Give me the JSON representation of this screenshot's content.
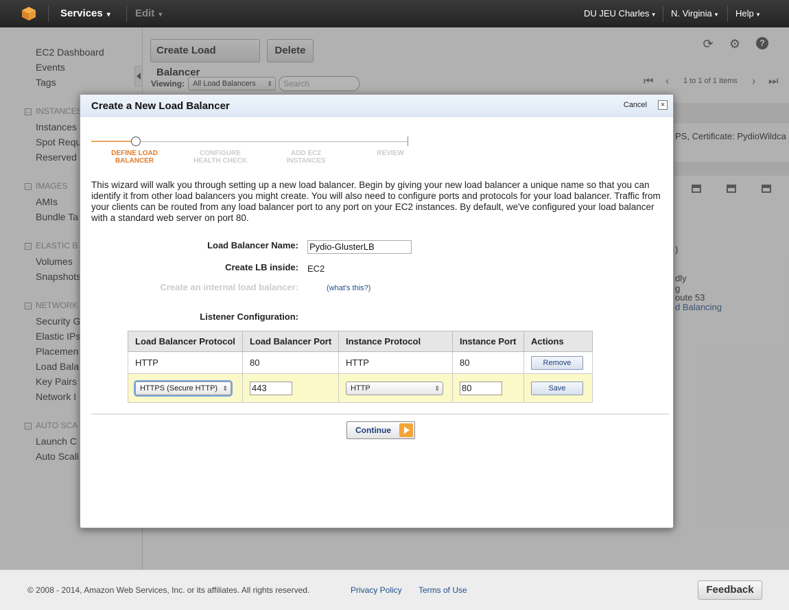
{
  "topbar": {
    "services_label": "Services",
    "edit_label": "Edit",
    "user_label": "DU JEU Charles",
    "region_label": "N. Virginia",
    "help_label": "Help"
  },
  "sidebar": {
    "items": [
      {
        "label": "EC2 Dashboard"
      },
      {
        "label": "Events"
      },
      {
        "label": "Tags"
      },
      {
        "label": "Instances"
      },
      {
        "label": "Spot Requ"
      },
      {
        "label": "Reserved"
      },
      {
        "label": "AMIs"
      },
      {
        "label": "Bundle Ta"
      },
      {
        "label": "Volumes"
      },
      {
        "label": "Snapshots"
      },
      {
        "label": "Security G"
      },
      {
        "label": "Elastic IPs"
      },
      {
        "label": "Placemen"
      },
      {
        "label": "Load Bala"
      },
      {
        "label": "Key Pairs"
      },
      {
        "label": "Network I"
      },
      {
        "label": "Launch C"
      },
      {
        "label": "Auto Scali"
      }
    ],
    "sections": [
      {
        "label": "INSTANCES"
      },
      {
        "label": "IMAGES"
      },
      {
        "label": "ELASTIC B"
      },
      {
        "label": "NETWORK"
      },
      {
        "label": "AUTO SCA"
      }
    ]
  },
  "toolbar": {
    "create_label": "Create Load Balancer",
    "delete_label": "Delete",
    "viewing_label": "Viewing:",
    "viewing_value": "All Load Balancers",
    "search_placeholder": "Search",
    "pager_text": "1 to 1 of 1 Items"
  },
  "background": {
    "row_text": "PS, Certificate: PydioWildca",
    "detail_1": ")",
    "detail_2": "dly",
    "detail_3": "g",
    "detail_4": "oute 53",
    "detail_5": "d Balancing"
  },
  "modal": {
    "title": "Create a New Load Balancer",
    "cancel_label": "Cancel",
    "close_symbol": "×",
    "steps": [
      {
        "line1": "DEFINE LOAD",
        "line2": "BALANCER"
      },
      {
        "line1": "CONFIGURE",
        "line2": "HEALTH CHECK"
      },
      {
        "line1": "ADD EC2",
        "line2": "INSTANCES"
      },
      {
        "line1": "REVIEW",
        "line2": ""
      }
    ],
    "intro": "This wizard will walk you through setting up a new load balancer. Begin by giving your new load balancer a unique name so that you can identify it from other load balancers you might create. You will also need to configure ports and protocols for your load balancer. Traffic from your clients can be routed from any load balancer port to any port on your EC2 instances. By default, we've configured your load balancer with a standard web server on port 80.",
    "name_label": "Load Balancer Name:",
    "name_value": "Pydio-GlusterLB",
    "inside_label": "Create LB inside:",
    "inside_value": "EC2",
    "internal_label": "Create an internal load balancer:",
    "whats_this": "(what's this?)",
    "listener_label": "Listener Configuration:",
    "table": {
      "headers": [
        "Load Balancer Protocol",
        "Load Balancer Port",
        "Instance Protocol",
        "Instance Port",
        "Actions"
      ],
      "row": {
        "lb_protocol": "HTTP",
        "lb_port": "80",
        "inst_protocol": "HTTP",
        "inst_port": "80",
        "action": "Remove"
      },
      "edit_row": {
        "lb_protocol": "HTTPS (Secure HTTP)",
        "lb_port": "443",
        "inst_protocol": "HTTP",
        "inst_port": "80",
        "action": "Save"
      }
    },
    "continue_label": "Continue"
  },
  "footer": {
    "copyright": "© 2008 - 2014, Amazon Web Services, Inc. or its affiliates. All rights reserved.",
    "privacy": "Privacy Policy",
    "terms": "Terms of Use",
    "feedback": "Feedback"
  }
}
